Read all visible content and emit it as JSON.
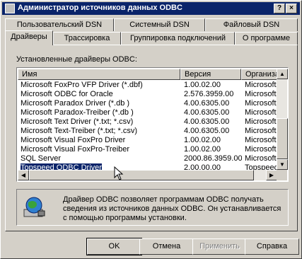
{
  "window": {
    "title": "Администратор источников данных ODBC"
  },
  "title_buttons": {
    "help": "?",
    "close": "×"
  },
  "tabs_back": [
    "Пользовательский DSN",
    "Системный DSN",
    "Файловый DSN"
  ],
  "tabs_front": [
    "Драйверы",
    "Трассировка",
    "Группировка подключений",
    "О программе"
  ],
  "active_tab": "Драйверы",
  "drivers_label": "Установленные драйверы ODBC:",
  "list": {
    "columns": [
      "Имя",
      "Версия",
      "Организа"
    ],
    "rows": [
      {
        "name": "Microsoft FoxPro VFP Driver (*.dbf)",
        "version": "1.00.02.00",
        "org": "Microsoft C"
      },
      {
        "name": "Microsoft ODBC for Oracle",
        "version": "2.576.3959.00",
        "org": "Microsoft C"
      },
      {
        "name": "Microsoft Paradox Driver (*.db )",
        "version": "4.00.6305.00",
        "org": "Microsoft C"
      },
      {
        "name": "Microsoft Paradox-Treiber (*.db )",
        "version": "4.00.6305.00",
        "org": "Microsoft C"
      },
      {
        "name": "Microsoft Text Driver (*.txt; *.csv)",
        "version": "4.00.6305.00",
        "org": "Microsoft C"
      },
      {
        "name": "Microsoft Text-Treiber (*.txt; *.csv)",
        "version": "4.00.6305.00",
        "org": "Microsoft C"
      },
      {
        "name": "Microsoft Visual FoxPro Driver",
        "version": "1.00.02.00",
        "org": "Microsoft C"
      },
      {
        "name": "Microsoft Visual FoxPro-Treiber",
        "version": "1.00.02.00",
        "org": "Microsoft C"
      },
      {
        "name": "SQL Server",
        "version": "2000.86.3959.00",
        "org": "Microsoft C"
      },
      {
        "name": "Topspeed ODBC Driver",
        "version": "2.00.00.00",
        "org": "Topspeed C"
      }
    ],
    "selected_index": 9
  },
  "info": {
    "text": "Драйвер ODBC позволяет программам ODBC получать сведения из источников данных ODBC.  Он устанавливается с помощью программы установки.",
    "icon": "odbc-globe-icon"
  },
  "buttons": {
    "ok": "OK",
    "cancel": "Отмена",
    "apply": "Применить",
    "help": "Справка"
  }
}
